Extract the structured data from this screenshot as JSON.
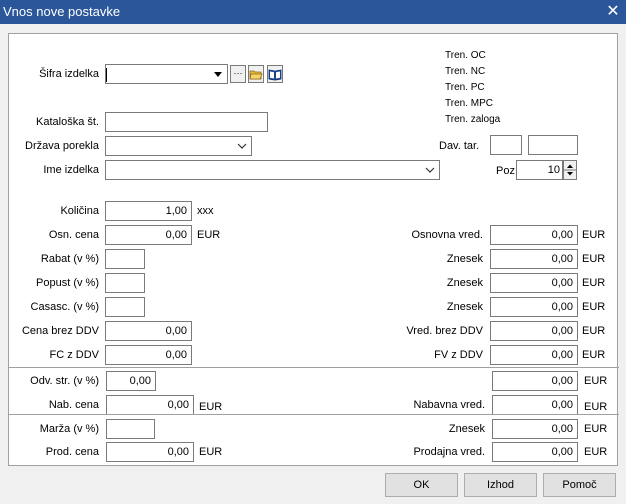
{
  "window": {
    "title": "Vnos nove postavke",
    "close_glyph": "✕"
  },
  "info_right": [
    "Tren. OC",
    "Tren. NC",
    "Tren. PC",
    "Tren. MPC",
    "Tren. zaloga"
  ],
  "top": {
    "sifra_label": "Šifra izdelka",
    "sifra_value": "",
    "ellipsis": "···",
    "katalog_label": "Kataloška št.",
    "katalog_value": "",
    "drzava_label": "Država porekla",
    "drzava_value": "",
    "ime_label": "Ime izdelka",
    "ime_value": "",
    "dav_label": "Dav. tar.",
    "dav_value1": "",
    "dav_value2": "",
    "poz_label": "Poz",
    "poz_value": "10"
  },
  "left": {
    "kolicina_label": "Količina",
    "kolicina_value": "1,00",
    "kolicina_unit": "xxx",
    "osn_cena_label": "Osn. cena",
    "osn_cena_value": "0,00",
    "osn_cena_unit": "EUR",
    "rabat_label": "Rabat (v %)",
    "rabat_value": "",
    "popust_label": "Popust (v %)",
    "popust_value": "",
    "casasc_label": "Casasc. (v %)",
    "casasc_value": "",
    "cena_brez_label": "Cena brez DDV",
    "cena_brez_value": "0,00",
    "fc_label": "FC z DDV",
    "fc_value": "0,00",
    "odv_label": "Odv. str. (v %)",
    "odv_value": "0,00",
    "nab_cena_label": "Nab. cena",
    "nab_cena_value": "0,00",
    "nab_cena_unit": "EUR",
    "marza_label": "Marža (v %)",
    "marza_value": "",
    "prod_cena_label": "Prod. cena",
    "prod_cena_value": "0,00",
    "prod_cena_unit": "EUR"
  },
  "right": {
    "osnovna_label": "Osnovna vred.",
    "osnovna_value": "0,00",
    "znesek1_label": "Znesek",
    "znesek1_value": "0,00",
    "znesek2_label": "Znesek",
    "znesek2_value": "0,00",
    "znesek3_label": "Znesek",
    "znesek3_value": "0,00",
    "vred_brez_label": "Vred. brez DDV",
    "vred_brez_value": "0,00",
    "fv_label": "FV z DDV",
    "fv_value": "0,00",
    "odv_value": "0,00",
    "nabavna_label": "Nabavna vred.",
    "nabavna_value": "0,00",
    "znesek4_label": "Znesek",
    "znesek4_value": "0,00",
    "prodajna_label": "Prodajna vred.",
    "prodajna_value": "0,00",
    "unit": "EUR"
  },
  "buttons": {
    "ok": "OK",
    "izhod": "Izhod",
    "pomoc": "Pomoč"
  }
}
